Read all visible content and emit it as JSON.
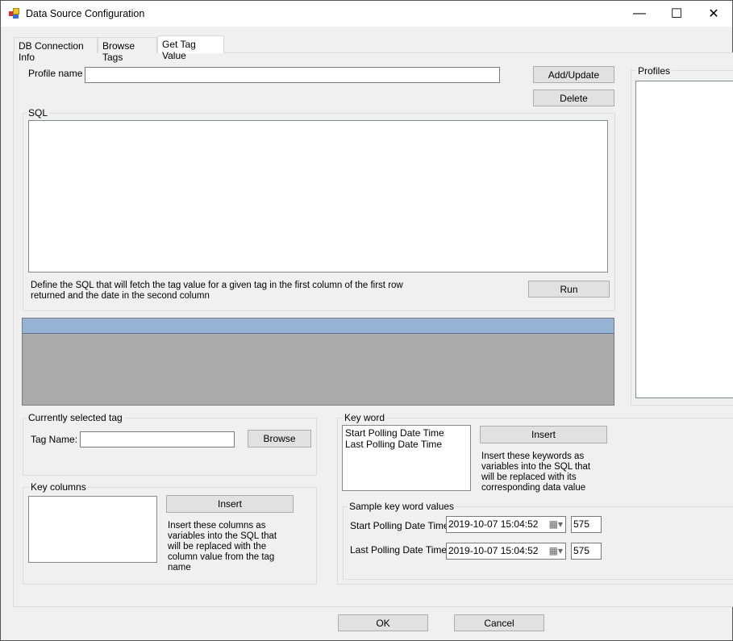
{
  "window": {
    "title": "Data Source Configuration",
    "minimize": "—",
    "maximize": "☐",
    "close": "✕"
  },
  "tabs": [
    {
      "label": "DB Connection Info"
    },
    {
      "label": "Browse Tags"
    },
    {
      "label": "Get Tag Value"
    }
  ],
  "profile": {
    "label": "Profile name",
    "value": "",
    "add_update": "Add/Update",
    "delete": "Delete"
  },
  "profiles": {
    "label": "Profiles"
  },
  "sql": {
    "label": "SQL",
    "value": "",
    "hint": "Define the SQL that will fetch the tag value for a given tag in the first column of the first row returned and the date in the second column",
    "run": "Run"
  },
  "current_tag": {
    "label": "Currently selected tag",
    "tag_name_label": "Tag Name:",
    "tag_name_value": "",
    "browse": "Browse"
  },
  "key_columns": {
    "label": "Key columns",
    "insert": "Insert",
    "hint": "Insert these columns as variables into the SQL that will be replaced with the column value from the tag name"
  },
  "key_word": {
    "label": "Key word",
    "items": [
      "Start Polling Date Time",
      "Last Polling Date Time"
    ],
    "insert": "Insert",
    "hint": "Insert these keywords as variables into the SQL that will be replaced with its corresponding data value"
  },
  "sample": {
    "label": "Sample key word values",
    "start_label": "Start Polling Date Time:",
    "start_value": "2019-10-07 15:04:52",
    "start_num": "575",
    "last_label": "Last Polling Date Time:",
    "last_value": "2019-10-07 15:04:52",
    "last_num": "575"
  },
  "footer": {
    "ok": "OK",
    "cancel": "Cancel"
  }
}
